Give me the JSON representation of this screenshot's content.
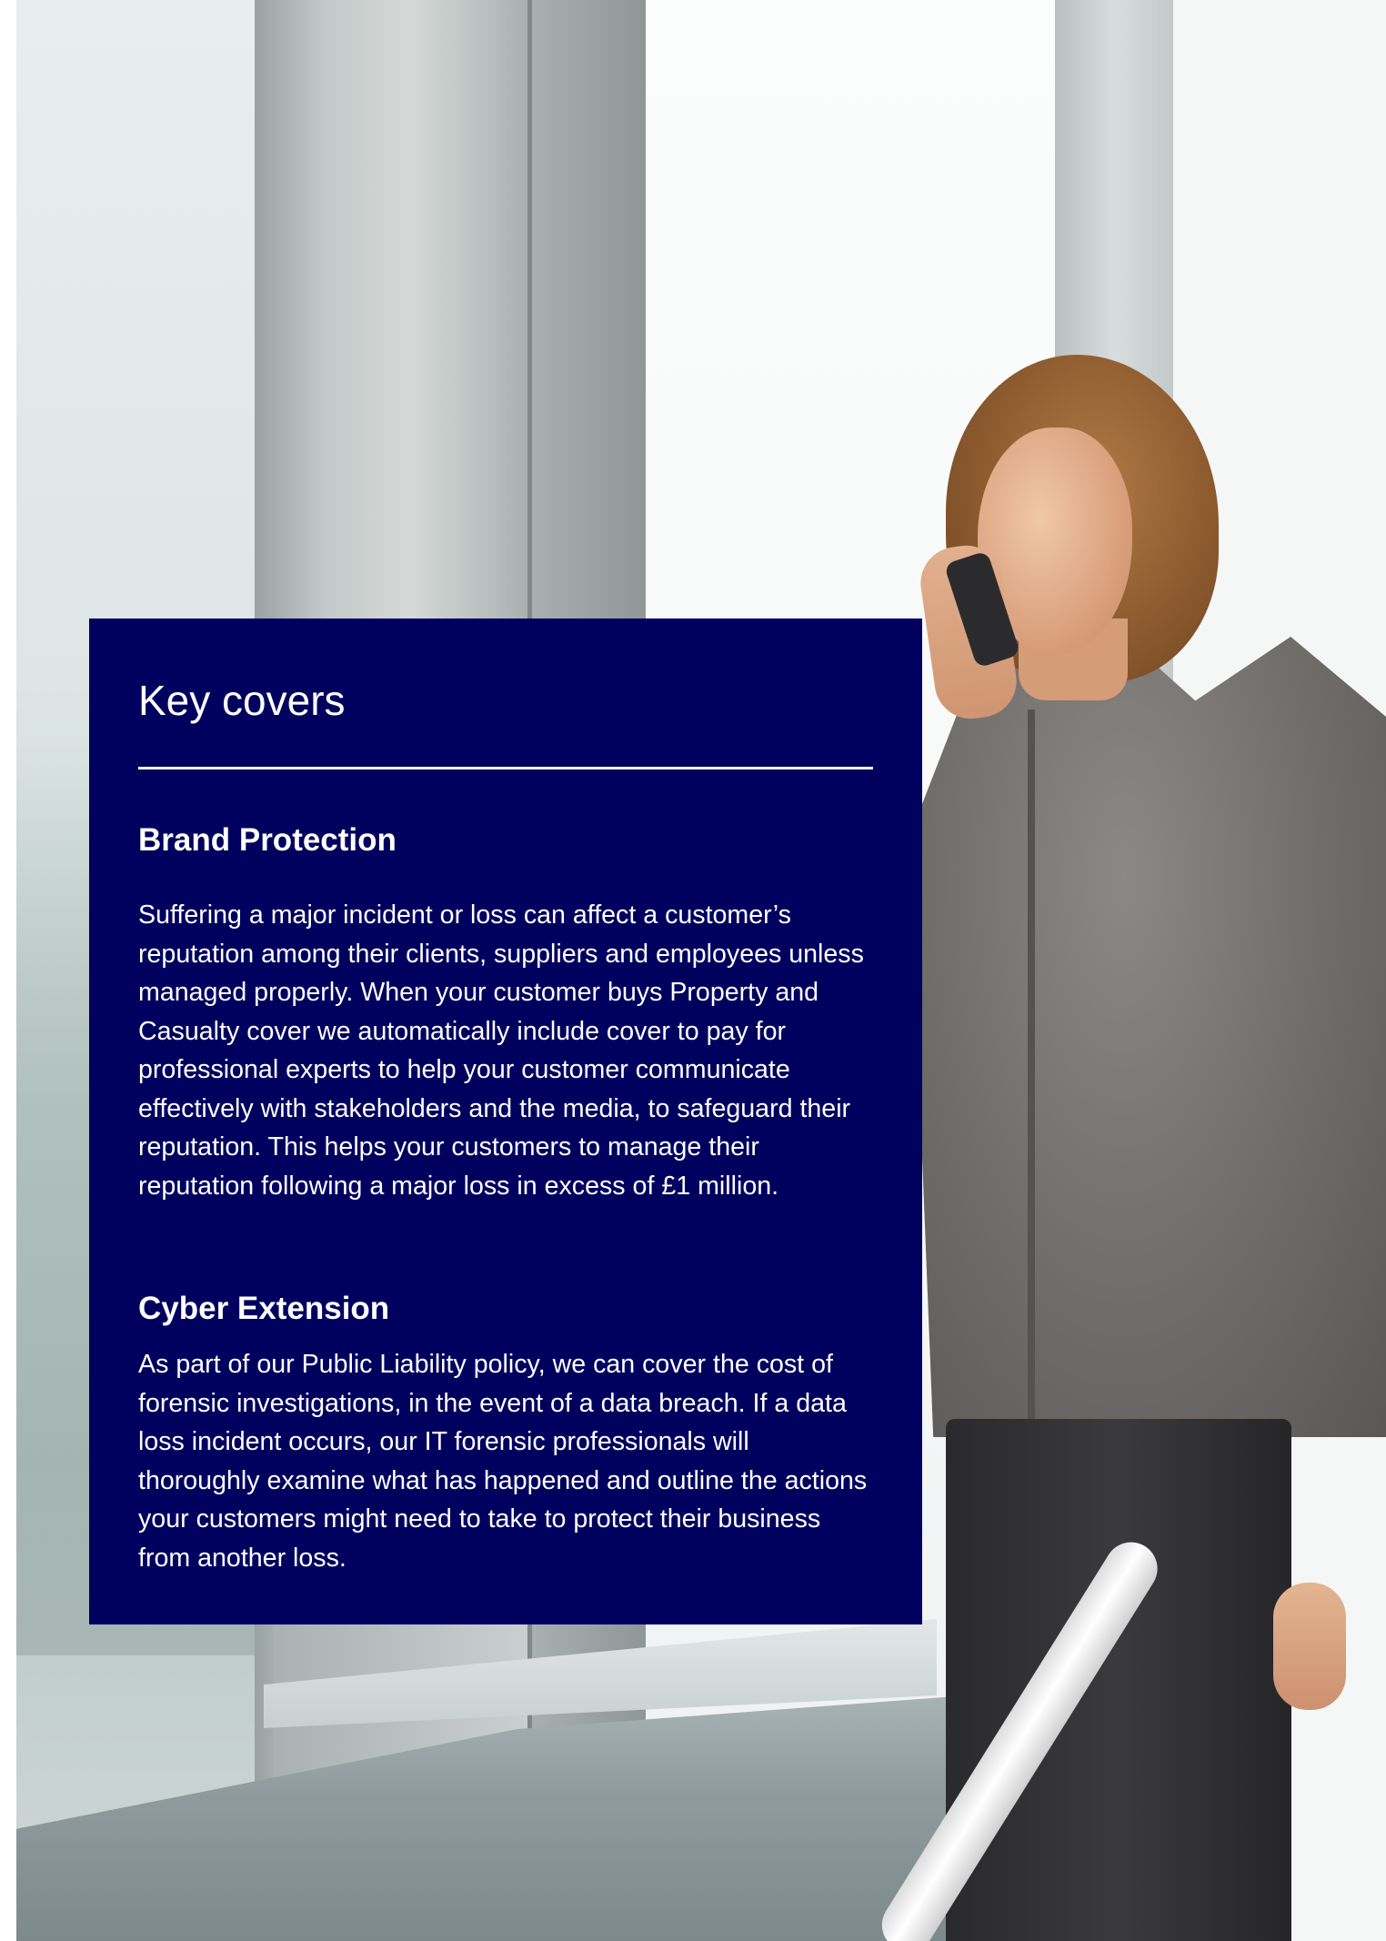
{
  "panel": {
    "heading": "Key covers",
    "sections": [
      {
        "title": "Brand Protection",
        "body": "Suffering a major incident or loss can affect a customer’s reputation among their clients, suppliers and employees unless managed properly. When your customer buys Property and Casualty cover we automatically include cover to pay for professional experts to help your customer communicate effectively with stakeholders and the media, to safeguard their reputation. This helps your customers to manage their reputation following a major loss in excess of £1 million."
      },
      {
        "title": "Cyber Extension",
        "body": "As part of our Public Liability policy, we can cover the cost of forensic investigations, in the event of a data breach. If a data loss incident occurs, our IT forensic professionals will thoroughly examine what has happened and outline the actions your customers might need to take to protect their business from another loss."
      }
    ]
  },
  "colors": {
    "panel_background": "#00005f",
    "panel_text": "#ffffff"
  }
}
